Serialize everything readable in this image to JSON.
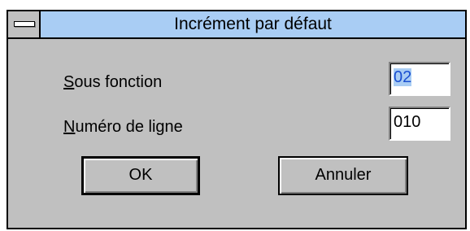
{
  "dialog": {
    "title": "Incrément par défaut",
    "fields": [
      {
        "label_mnemonic": "S",
        "label_rest": "ous fonction",
        "selected_value": "02",
        "value": ""
      },
      {
        "label_mnemonic": "N",
        "label_rest": "uméro de ligne",
        "selected_value": "",
        "value": "010"
      }
    ],
    "buttons": {
      "ok_label": "OK",
      "cancel_label": "Annuler"
    }
  },
  "colors": {
    "title_bar": "#a9cdf4",
    "dialog_background": "#c0c0c0",
    "selection_text": "#1a4fd0"
  },
  "icons": {
    "system_menu": "system-menu-icon"
  }
}
